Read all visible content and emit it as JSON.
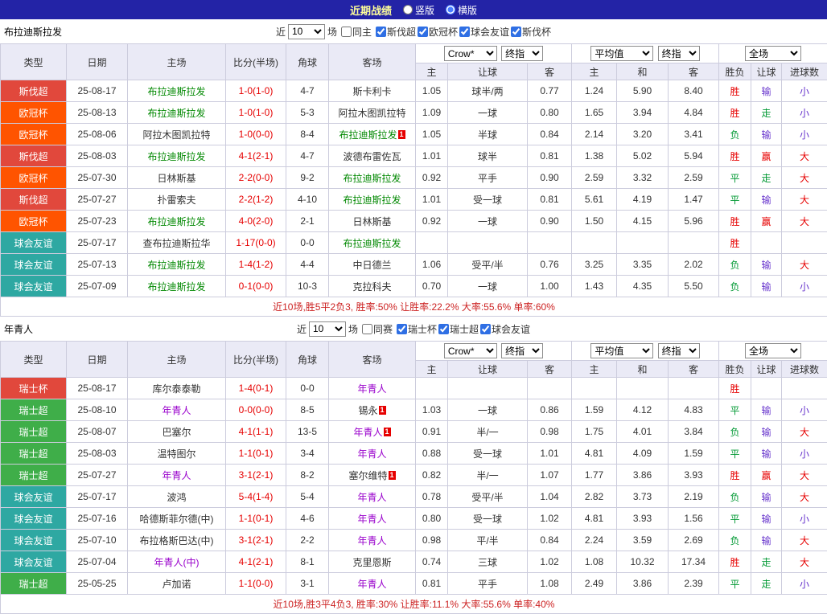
{
  "topbar": {
    "title": "近期战绩",
    "radios": [
      {
        "label": "竖版",
        "selected": false
      },
      {
        "label": "横版",
        "selected": true
      }
    ]
  },
  "columns": {
    "type": "类型",
    "date": "日期",
    "home": "主场",
    "score": "比分(半场)",
    "corner": "角球",
    "away": "客场",
    "sub": [
      "主",
      "让球",
      "客",
      "主",
      "和",
      "客",
      "胜负",
      "让球",
      "进球数"
    ]
  },
  "dropdowns": {
    "company": "Crow*",
    "final": "终指",
    "average": "平均值",
    "fulltime": "全场"
  },
  "type_colors": {
    "斯伐超": "#e1483c",
    "欧冠杯": "#ff5400",
    "球会友谊": "#2ea8a2",
    "瑞士杯": "#e1483c",
    "瑞士超": "#3fae49"
  },
  "palette": {
    "outcome": {
      "胜": "#e60000",
      "平": "#009933",
      "负": "#009933",
      "赢": "#e60000",
      "走": "#009933",
      "输": "#6633cc",
      "大": "#e60000",
      "小": "#6633cc"
    },
    "score_color": "#e60000",
    "summary_color": "#cc2222",
    "topbar_bg": "#2323a6",
    "title_color": "#ffff99"
  },
  "sections": [
    {
      "team": "布拉迪斯拉发",
      "highlight_color": "#008800",
      "filter": {
        "near": "近",
        "count": "10",
        "games": "场",
        "same": {
          "label": "同主",
          "checked": false
        },
        "leagues": [
          {
            "label": "斯伐超",
            "checked": true
          },
          {
            "label": "欧冠杯",
            "checked": true
          },
          {
            "label": "球会友谊",
            "checked": true
          },
          {
            "label": "斯伐杯",
            "checked": true
          }
        ]
      },
      "rows": [
        {
          "type": "斯伐超",
          "date": "25-08-17",
          "home": "布拉迪斯拉发",
          "home_hl": true,
          "home_rc": false,
          "score": "1-0(1-0)",
          "corner": "4-7",
          "away": "斯卡利卡",
          "away_hl": false,
          "away_rc": false,
          "odds": [
            "1.05",
            "球半/两",
            "0.77",
            "1.24",
            "5.90",
            "8.40"
          ],
          "result": "胜",
          "handicap": "输",
          "goals": "小"
        },
        {
          "type": "欧冠杯",
          "date": "25-08-13",
          "home": "布拉迪斯拉发",
          "home_hl": true,
          "home_rc": false,
          "score": "1-0(1-0)",
          "corner": "5-3",
          "away": "阿拉木图凯拉特",
          "away_hl": false,
          "away_rc": false,
          "odds": [
            "1.09",
            "一球",
            "0.80",
            "1.65",
            "3.94",
            "4.84"
          ],
          "result": "胜",
          "handicap": "走",
          "goals": "小"
        },
        {
          "type": "欧冠杯",
          "date": "25-08-06",
          "home": "阿拉木图凯拉特",
          "home_hl": false,
          "home_rc": false,
          "score": "1-0(0-0)",
          "corner": "8-4",
          "away": "布拉迪斯拉发",
          "away_hl": true,
          "away_rc": true,
          "odds": [
            "1.05",
            "半球",
            "0.84",
            "2.14",
            "3.20",
            "3.41"
          ],
          "result": "负",
          "handicap": "输",
          "goals": "小"
        },
        {
          "type": "斯伐超",
          "date": "25-08-03",
          "home": "布拉迪斯拉发",
          "home_hl": true,
          "home_rc": false,
          "score": "4-1(2-1)",
          "corner": "4-7",
          "away": "波德布雷佐瓦",
          "away_hl": false,
          "away_rc": false,
          "odds": [
            "1.01",
            "球半",
            "0.81",
            "1.38",
            "5.02",
            "5.94"
          ],
          "result": "胜",
          "handicap": "赢",
          "goals": "大"
        },
        {
          "type": "欧冠杯",
          "date": "25-07-30",
          "home": "日林斯基",
          "home_hl": false,
          "home_rc": false,
          "score": "2-2(0-0)",
          "corner": "9-2",
          "away": "布拉迪斯拉发",
          "away_hl": true,
          "away_rc": false,
          "odds": [
            "0.92",
            "平手",
            "0.90",
            "2.59",
            "3.32",
            "2.59"
          ],
          "result": "平",
          "handicap": "走",
          "goals": "大"
        },
        {
          "type": "斯伐超",
          "date": "25-07-27",
          "home": "扑雷索夫",
          "home_hl": false,
          "home_rc": false,
          "score": "2-2(1-2)",
          "corner": "4-10",
          "away": "布拉迪斯拉发",
          "away_hl": true,
          "away_rc": false,
          "odds": [
            "1.01",
            "受一球",
            "0.81",
            "5.61",
            "4.19",
            "1.47"
          ],
          "result": "平",
          "handicap": "输",
          "goals": "大"
        },
        {
          "type": "欧冠杯",
          "date": "25-07-23",
          "home": "布拉迪斯拉发",
          "home_hl": true,
          "home_rc": false,
          "score": "4-0(2-0)",
          "corner": "2-1",
          "away": "日林斯基",
          "away_hl": false,
          "away_rc": false,
          "odds": [
            "0.92",
            "一球",
            "0.90",
            "1.50",
            "4.15",
            "5.96"
          ],
          "result": "胜",
          "handicap": "赢",
          "goals": "大"
        },
        {
          "type": "球会友谊",
          "date": "25-07-17",
          "home": "查布拉迪斯拉华",
          "home_hl": false,
          "home_rc": false,
          "score": "1-17(0-0)",
          "corner": "0-0",
          "away": "布拉迪斯拉发",
          "away_hl": true,
          "away_rc": false,
          "odds": [
            "",
            "",
            "",
            "",
            "",
            ""
          ],
          "result": "胜",
          "handicap": "",
          "goals": ""
        },
        {
          "type": "球会友谊",
          "date": "25-07-13",
          "home": "布拉迪斯拉发",
          "home_hl": true,
          "home_rc": false,
          "score": "1-4(1-2)",
          "corner": "4-4",
          "away": "中日德兰",
          "away_hl": false,
          "away_rc": false,
          "odds": [
            "1.06",
            "受平/半",
            "0.76",
            "3.25",
            "3.35",
            "2.02"
          ],
          "result": "负",
          "handicap": "输",
          "goals": "大"
        },
        {
          "type": "球会友谊",
          "date": "25-07-09",
          "home": "布拉迪斯拉发",
          "home_hl": true,
          "home_rc": false,
          "score": "0-1(0-0)",
          "corner": "10-3",
          "away": "克拉科夫",
          "away_hl": false,
          "away_rc": false,
          "odds": [
            "0.70",
            "一球",
            "1.00",
            "1.43",
            "4.35",
            "5.50"
          ],
          "result": "负",
          "handicap": "输",
          "goals": "小"
        }
      ],
      "summary": "近10场,胜5平2负3, 胜率:50% 让胜率:22.2% 大率:55.6% 单率:60%"
    },
    {
      "team": "年青人",
      "highlight_color": "#9900cc",
      "filter": {
        "near": "近",
        "count": "10",
        "games": "场",
        "same": {
          "label": "同赛",
          "checked": false
        },
        "leagues": [
          {
            "label": "瑞士杯",
            "checked": true
          },
          {
            "label": "瑞士超",
            "checked": true
          },
          {
            "label": "球会友谊",
            "checked": true
          }
        ]
      },
      "rows": [
        {
          "type": "瑞士杯",
          "date": "25-08-17",
          "home": "库尔泰泰勒",
          "home_hl": false,
          "home_rc": false,
          "score": "1-4(0-1)",
          "corner": "0-0",
          "away": "年青人",
          "away_hl": true,
          "away_rc": false,
          "odds": [
            "",
            "",
            "",
            "",
            "",
            ""
          ],
          "result": "胜",
          "handicap": "",
          "goals": ""
        },
        {
          "type": "瑞士超",
          "date": "25-08-10",
          "home": "年青人",
          "home_hl": true,
          "home_rc": false,
          "score": "0-0(0-0)",
          "corner": "8-5",
          "away": "锡永",
          "away_hl": false,
          "away_rc": true,
          "odds": [
            "1.03",
            "一球",
            "0.86",
            "1.59",
            "4.12",
            "4.83"
          ],
          "result": "平",
          "handicap": "输",
          "goals": "小"
        },
        {
          "type": "瑞士超",
          "date": "25-08-07",
          "home": "巴塞尔",
          "home_hl": false,
          "home_rc": false,
          "score": "4-1(1-1)",
          "corner": "13-5",
          "away": "年青人",
          "away_hl": true,
          "away_rc": true,
          "odds": [
            "0.91",
            "半/一",
            "0.98",
            "1.75",
            "4.01",
            "3.84"
          ],
          "result": "负",
          "handicap": "输",
          "goals": "大"
        },
        {
          "type": "瑞士超",
          "date": "25-08-03",
          "home": "温特图尔",
          "home_hl": false,
          "home_rc": false,
          "score": "1-1(0-1)",
          "corner": "3-4",
          "away": "年青人",
          "away_hl": true,
          "away_rc": false,
          "odds": [
            "0.88",
            "受一球",
            "1.01",
            "4.81",
            "4.09",
            "1.59"
          ],
          "result": "平",
          "handicap": "输",
          "goals": "小"
        },
        {
          "type": "瑞士超",
          "date": "25-07-27",
          "home": "年青人",
          "home_hl": true,
          "home_rc": false,
          "score": "3-1(2-1)",
          "corner": "8-2",
          "away": "塞尔维特",
          "away_hl": false,
          "away_rc": true,
          "odds": [
            "0.82",
            "半/一",
            "1.07",
            "1.77",
            "3.86",
            "3.93"
          ],
          "result": "胜",
          "handicap": "赢",
          "goals": "大"
        },
        {
          "type": "球会友谊",
          "date": "25-07-17",
          "home": "波鸿",
          "home_hl": false,
          "home_rc": false,
          "score": "5-4(1-4)",
          "corner": "5-4",
          "away": "年青人",
          "away_hl": true,
          "away_rc": false,
          "odds": [
            "0.78",
            "受平/半",
            "1.04",
            "2.82",
            "3.73",
            "2.19"
          ],
          "result": "负",
          "handicap": "输",
          "goals": "大"
        },
        {
          "type": "球会友谊",
          "date": "25-07-16",
          "home": "哈德斯菲尔德(中)",
          "home_hl": false,
          "home_rc": false,
          "score": "1-1(0-1)",
          "corner": "4-6",
          "away": "年青人",
          "away_hl": true,
          "away_rc": false,
          "odds": [
            "0.80",
            "受一球",
            "1.02",
            "4.81",
            "3.93",
            "1.56"
          ],
          "result": "平",
          "handicap": "输",
          "goals": "小"
        },
        {
          "type": "球会友谊",
          "date": "25-07-10",
          "home": "布拉格斯巴达(中)",
          "home_hl": false,
          "home_rc": false,
          "score": "3-1(2-1)",
          "corner": "2-2",
          "away": "年青人",
          "away_hl": true,
          "away_rc": false,
          "odds": [
            "0.98",
            "平/半",
            "0.84",
            "2.24",
            "3.59",
            "2.69"
          ],
          "result": "负",
          "handicap": "输",
          "goals": "大"
        },
        {
          "type": "球会友谊",
          "date": "25-07-04",
          "home": "年青人(中)",
          "home_hl": true,
          "home_rc": false,
          "score": "4-1(2-1)",
          "corner": "8-1",
          "away": "克里恩斯",
          "away_hl": false,
          "away_rc": false,
          "odds": [
            "0.74",
            "三球",
            "1.02",
            "1.08",
            "10.32",
            "17.34"
          ],
          "result": "胜",
          "handicap": "走",
          "goals": "大"
        },
        {
          "type": "瑞士超",
          "date": "25-05-25",
          "home": "卢加诺",
          "home_hl": false,
          "home_rc": false,
          "score": "1-1(0-0)",
          "corner": "3-1",
          "away": "年青人",
          "away_hl": true,
          "away_rc": false,
          "odds": [
            "0.81",
            "平手",
            "1.08",
            "2.49",
            "3.86",
            "2.39"
          ],
          "result": "平",
          "handicap": "走",
          "goals": "小"
        }
      ],
      "summary": "近10场,胜3平4负3, 胜率:30% 让胜率:11.1% 大率:55.6% 单率:40%"
    }
  ]
}
